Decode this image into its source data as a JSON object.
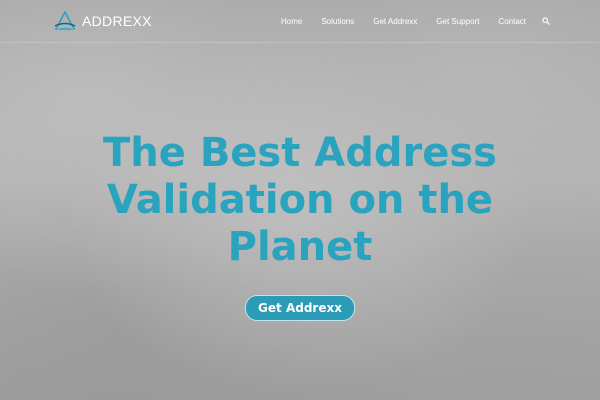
{
  "brand": {
    "name": "ADDREXX",
    "logo_icon": "mountain-logo-icon"
  },
  "nav": {
    "items": [
      {
        "label": "Home"
      },
      {
        "label": "Solutions"
      },
      {
        "label": "Get Addrexx"
      },
      {
        "label": "Get Support"
      },
      {
        "label": "Contact"
      }
    ],
    "search_icon": "search-icon"
  },
  "hero": {
    "title_lines": [
      "The Best Address",
      "Validation on the",
      "Planet"
    ],
    "cta_label": "Get Addrexx"
  },
  "colors": {
    "accent": "#2aa3bf",
    "button": "#2b9bb6",
    "nav_text": "#ffffff",
    "background": "#a9a9a9"
  }
}
